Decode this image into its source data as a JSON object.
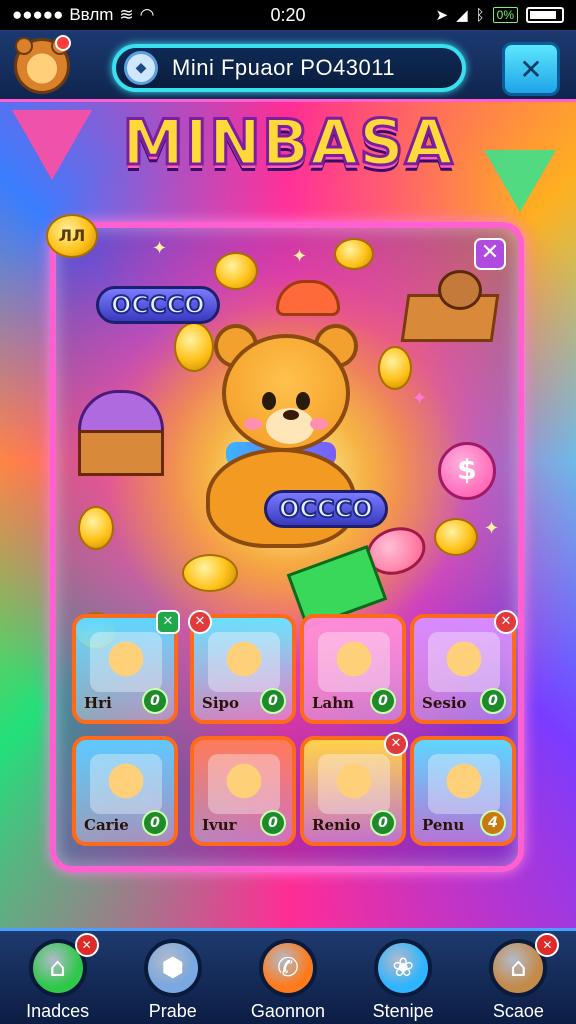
{
  "status_bar": {
    "carrier": "Bвлm",
    "time": "0:20",
    "battery_label": "0%"
  },
  "header": {
    "title": "Mini Fpuaor PO43011",
    "pill_icon": "compass-icon",
    "settings_icon": "wrench-icon",
    "avatar_icon": "bear-avatar-icon"
  },
  "logo": {
    "text": "MINBASA"
  },
  "board": {
    "close_icon": "close-icon",
    "badge_a": "OCCCO",
    "badge_b": "OCCCO",
    "token_symbol": "$",
    "small_coin_text": "ЛЛ"
  },
  "tiles": [
    {
      "label": "Hri",
      "count": "0",
      "x": "✕",
      "bg": "#5fd6ff"
    },
    {
      "label": "Sipo",
      "count": "0",
      "x": "✕",
      "bg": "#6adfff"
    },
    {
      "label": "Lahn",
      "count": "0",
      "x": "✕",
      "bg": "#ff8ad8"
    },
    {
      "label": "Sesio",
      "count": "0",
      "x": "✕",
      "bg": "#d88aff"
    },
    {
      "label": "Carie",
      "count": "0",
      "x": "",
      "bg": "#5fc8ff"
    },
    {
      "label": "Ivur",
      "count": "0",
      "x": "",
      "bg": "#ff7a5a"
    },
    {
      "label": "Renio",
      "count": "0",
      "x": "✕",
      "bg": "#ffd24a"
    },
    {
      "label": "Penu",
      "count": "4",
      "x": "",
      "bg": "#5fd6ff"
    }
  ],
  "bottom_nav": [
    {
      "label": "Inadces",
      "icon": "home-icon",
      "badge": "✕",
      "color": "#2fc84a"
    },
    {
      "label": "Prabe",
      "icon": "shield-icon",
      "badge": "",
      "color": "#7aa8e0"
    },
    {
      "label": "Gaonnon",
      "icon": "phone-icon",
      "badge": "",
      "color": "#ff7a1a"
    },
    {
      "label": "Stenipe",
      "icon": "flower-icon",
      "badge": "",
      "color": "#2fb4ff"
    },
    {
      "label": "Scaoe",
      "icon": "house-icon",
      "badge": "✕",
      "color": "#c48a4a"
    }
  ]
}
